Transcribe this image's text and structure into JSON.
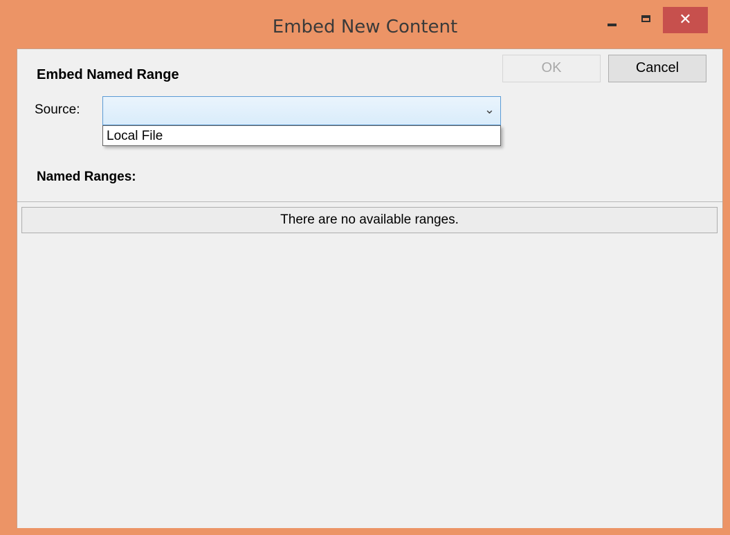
{
  "window": {
    "title": "Embed New Content",
    "accent_color": "#ec9466",
    "close_color": "#c7504d",
    "controls": {
      "minimize": "minimize-icon",
      "maximize": "maximize-icon",
      "close": "close-icon"
    }
  },
  "dialog": {
    "heading": "Embed Named Range",
    "ok_label": "OK",
    "cancel_label": "Cancel",
    "source": {
      "label": "Source:",
      "value": "",
      "options": [
        "Local File"
      ]
    },
    "named_ranges": {
      "label": "Named Ranges:",
      "empty_message": "There are no available ranges."
    }
  }
}
